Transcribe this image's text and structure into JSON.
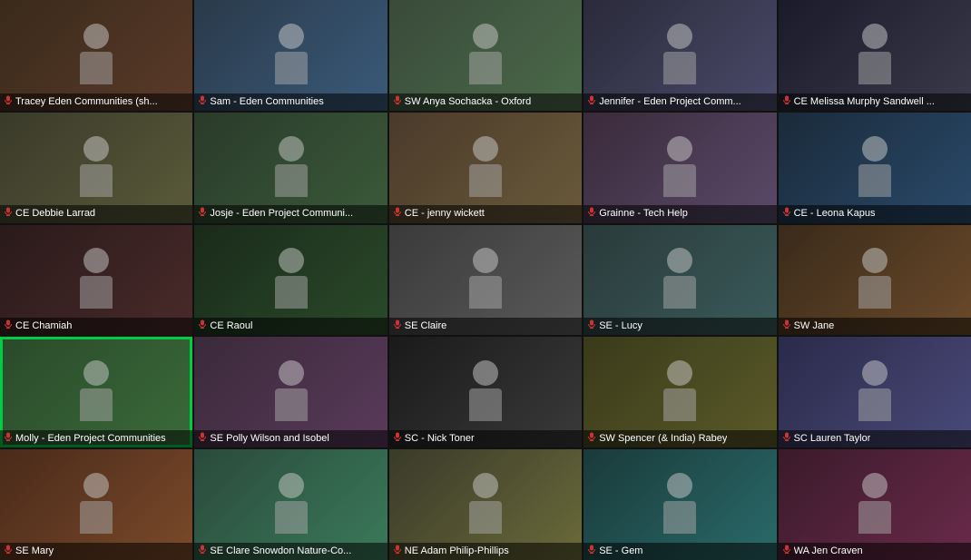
{
  "participants": [
    {
      "id": 1,
      "name": "Tracey Eden Communities  (sh...",
      "color": "c1",
      "highlighted": false
    },
    {
      "id": 2,
      "name": "Sam - Eden Communities",
      "color": "c2",
      "highlighted": false
    },
    {
      "id": 3,
      "name": "SW Anya Sochacka - Oxford",
      "color": "c3",
      "highlighted": false
    },
    {
      "id": 4,
      "name": "Jennifer - Eden Project Comm...",
      "color": "c4",
      "highlighted": false
    },
    {
      "id": 5,
      "name": "CE Melissa Murphy Sandwell ...",
      "color": "c5",
      "highlighted": false
    },
    {
      "id": 6,
      "name": "CE Debbie Larrad",
      "color": "c6",
      "highlighted": false
    },
    {
      "id": 7,
      "name": "Josje - Eden Project Communi...",
      "color": "c7",
      "highlighted": false
    },
    {
      "id": 8,
      "name": "CE - jenny wickett",
      "color": "c8",
      "highlighted": false
    },
    {
      "id": 9,
      "name": "Grainne - Tech Help",
      "color": "c9",
      "highlighted": false
    },
    {
      "id": 10,
      "name": "CE - Leona Kapus",
      "color": "c10",
      "highlighted": false
    },
    {
      "id": 11,
      "name": "CE Chamiah",
      "color": "c11",
      "highlighted": false
    },
    {
      "id": 12,
      "name": "CE Raoul",
      "color": "c12",
      "highlighted": false
    },
    {
      "id": 13,
      "name": "SE Claire",
      "color": "c13",
      "highlighted": false
    },
    {
      "id": 14,
      "name": "SE - Lucy",
      "color": "c14",
      "highlighted": false
    },
    {
      "id": 15,
      "name": "SW Jane",
      "color": "c15",
      "highlighted": false
    },
    {
      "id": 16,
      "name": "Molly - Eden Project Communities",
      "color": "c16",
      "highlighted": true
    },
    {
      "id": 17,
      "name": "SE Polly Wilson and Isobel",
      "color": "c17",
      "highlighted": false
    },
    {
      "id": 18,
      "name": "SC - Nick Toner",
      "color": "c18",
      "highlighted": false
    },
    {
      "id": 19,
      "name": "SW Spencer (& India) Rabey",
      "color": "c19",
      "highlighted": false
    },
    {
      "id": 20,
      "name": "SC Lauren Taylor",
      "color": "c20",
      "highlighted": false
    },
    {
      "id": 21,
      "name": "SE Mary",
      "color": "c21",
      "highlighted": false
    },
    {
      "id": 22,
      "name": "SE Clare Snowdon Nature-Co...",
      "color": "c22",
      "highlighted": false
    },
    {
      "id": 23,
      "name": "NE Adam Philip-Phillips",
      "color": "c23",
      "highlighted": false
    },
    {
      "id": 24,
      "name": "SE - Gem",
      "color": "c24",
      "highlighted": false
    },
    {
      "id": 25,
      "name": "WA Jen Craven",
      "color": "c25",
      "highlighted": false
    }
  ],
  "mic_icon": "🔇",
  "colors": {
    "label_bg": "rgba(0,0,0,0.55)",
    "label_text": "#ffffff",
    "highlight": "#00cc44"
  }
}
